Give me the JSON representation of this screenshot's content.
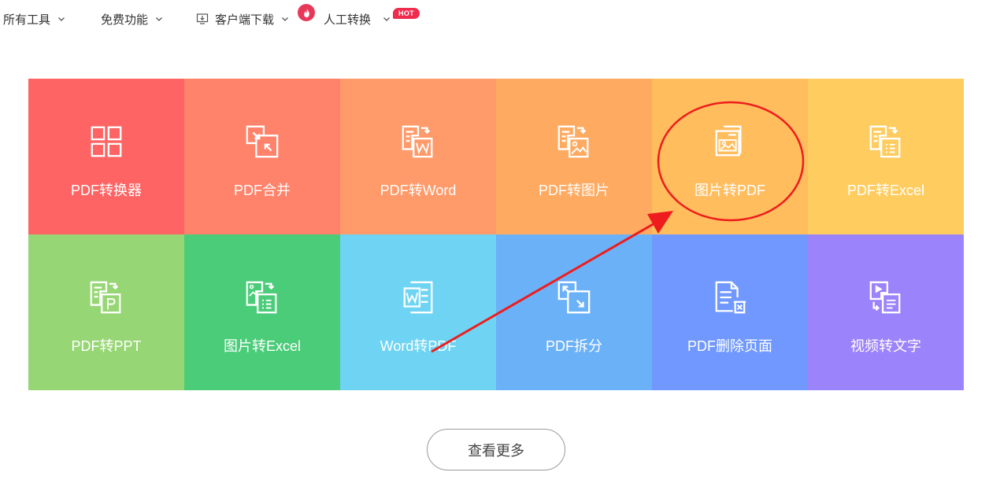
{
  "nav": {
    "all_tools": "所有工具",
    "free_features": "免费功能",
    "client_download": "客户端下载",
    "human_convert": "人工转换",
    "hot_badge": "HOT"
  },
  "tools": [
    {
      "label": "PDF转换器",
      "icon": "grid-icon",
      "color": "#ff6464"
    },
    {
      "label": "PDF合并",
      "icon": "merge-icon",
      "color": "#ff826b"
    },
    {
      "label": "PDF转Word",
      "icon": "pdf-to-word-icon",
      "color": "#ff9a6a"
    },
    {
      "label": "PDF转图片",
      "icon": "pdf-to-image-icon",
      "color": "#ffaa61"
    },
    {
      "label": "图片转PDF",
      "icon": "image-to-pdf-icon",
      "color": "#ffbd5e"
    },
    {
      "label": "PDF转Excel",
      "icon": "pdf-to-excel-icon",
      "color": "#ffcc5f"
    },
    {
      "label": "PDF转PPT",
      "icon": "pdf-to-ppt-icon",
      "color": "#97d675"
    },
    {
      "label": "图片转Excel",
      "icon": "image-to-excel-icon",
      "color": "#4bcc79"
    },
    {
      "label": "Word转PDF",
      "icon": "word-to-pdf-icon",
      "color": "#6fd4f3"
    },
    {
      "label": "PDF拆分",
      "icon": "split-icon",
      "color": "#6bb1f7"
    },
    {
      "label": "PDF删除页面",
      "icon": "delete-page-icon",
      "color": "#7098fe"
    },
    {
      "label": "视频转文字",
      "icon": "video-to-text-icon",
      "color": "#9b83fb"
    }
  ],
  "more_button": "查看更多",
  "annotation_color": "#ee1c1c"
}
